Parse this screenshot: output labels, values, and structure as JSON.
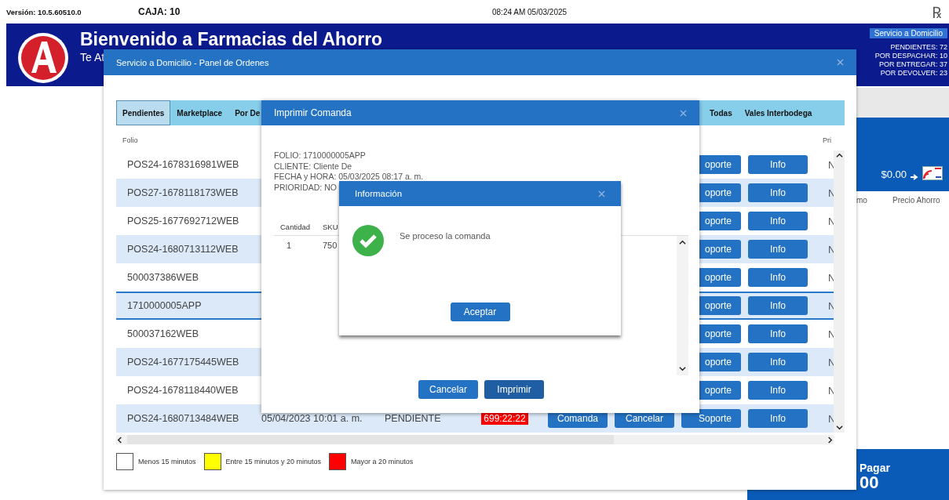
{
  "status_bar": {
    "version": "Versión: 10.5.60510.0",
    "register": "CAJA: 10",
    "datetime": "08:24 AM 05/03/2025",
    "rx_symbol": "℞"
  },
  "banner": {
    "title": "Bienvenido a Farmacias del Ahorro",
    "subtitle": "Te At",
    "service_badge": "Servicio a Domicilio",
    "counters": [
      "PENDIENTES: 72",
      "POR DESPACHAR: 10",
      "POR ENTREGAR: 37",
      "POR DEVOLVER: 23"
    ]
  },
  "side_panel": {
    "total": "$0.00",
    "column_1": "mo",
    "column_2": "Precio Ahorro",
    "pay_label": "Pagar",
    "pay_amount": "00"
  },
  "orders_dialog": {
    "title": "Servicio a Domicilio - Panel de Ordenes",
    "tabs": [
      {
        "label": "Pendientes",
        "selected": true
      },
      {
        "label": "Marketplace",
        "selected": false
      },
      {
        "label": "Por De",
        "selected": false
      },
      {
        "label": "Todas",
        "selected": false
      },
      {
        "label": "Vales Interbodega",
        "selected": false
      }
    ],
    "columns": [
      "Folio",
      "Pri"
    ],
    "rows": [
      {
        "folio": "POS24-1678316981WEB",
        "selected": false,
        "support": "oporte",
        "info": "Info",
        "priority": "N"
      },
      {
        "folio": "POS27-1678118173WEB",
        "selected": false,
        "support": "oporte",
        "info": "Info",
        "priority": "N"
      },
      {
        "folio": "POS25-1677692712WEB",
        "selected": false,
        "support": "oporte",
        "info": "Info",
        "priority": "N"
      },
      {
        "folio": "POS24-1680713112WEB",
        "selected": false,
        "support": "oporte",
        "info": "Info",
        "priority": "N"
      },
      {
        "folio": "500037386WEB",
        "selected": false,
        "support": "oporte",
        "info": "Info",
        "priority": "N"
      },
      {
        "folio": "1710000005APP",
        "selected": true,
        "support": "oporte",
        "info": "Info",
        "priority": "N"
      },
      {
        "folio": "500037162WEB",
        "selected": false,
        "support": "oporte",
        "info": "Info",
        "priority": "N"
      },
      {
        "folio": "POS24-1677175445WEB",
        "selected": false,
        "support": "oporte",
        "info": "Info",
        "priority": "N"
      },
      {
        "folio": "POS24-1678118440WEB",
        "selected": false,
        "support": "oporte",
        "info": "Info",
        "priority": "N"
      },
      {
        "folio": "POS24-1680713484WEB",
        "selected": false,
        "date": "05/04/2023 10:01 a. m.",
        "status": "PENDIENTE",
        "timer": "699:22:22",
        "color": "#ff0000",
        "comanda": "Comanda",
        "cancel": "Cancelar",
        "support": "Soporte",
        "info": "Info",
        "priority": "N"
      }
    ],
    "legend": [
      {
        "label": "Menos 15 minutos",
        "color": "#ffffff"
      },
      {
        "label": "Entre 15 minutos y 20 minutos",
        "color": "#ffff00"
      },
      {
        "label": "Mayor a 20 minutos",
        "color": "#ff0000"
      }
    ]
  },
  "print_dialog": {
    "title": "Imprimir Comanda",
    "details": [
      "FOLIO: 1710000005APP",
      "CLIENTE: Cliente De",
      "FECHA y HORA: 05/03/2025 08:17 a. m.",
      "PRIORIDAD: NO"
    ],
    "columns": [
      "Cantidad",
      "SKU"
    ],
    "rows": [
      [
        "1",
        "750"
      ]
    ],
    "buttons": [
      {
        "label": "Cancelar",
        "kind": "secondary"
      },
      {
        "label": "Imprimir",
        "kind": "primary"
      }
    ]
  },
  "info_dialog": {
    "title": "Información",
    "message": "Se proceso la comanda",
    "button": "Aceptar"
  }
}
